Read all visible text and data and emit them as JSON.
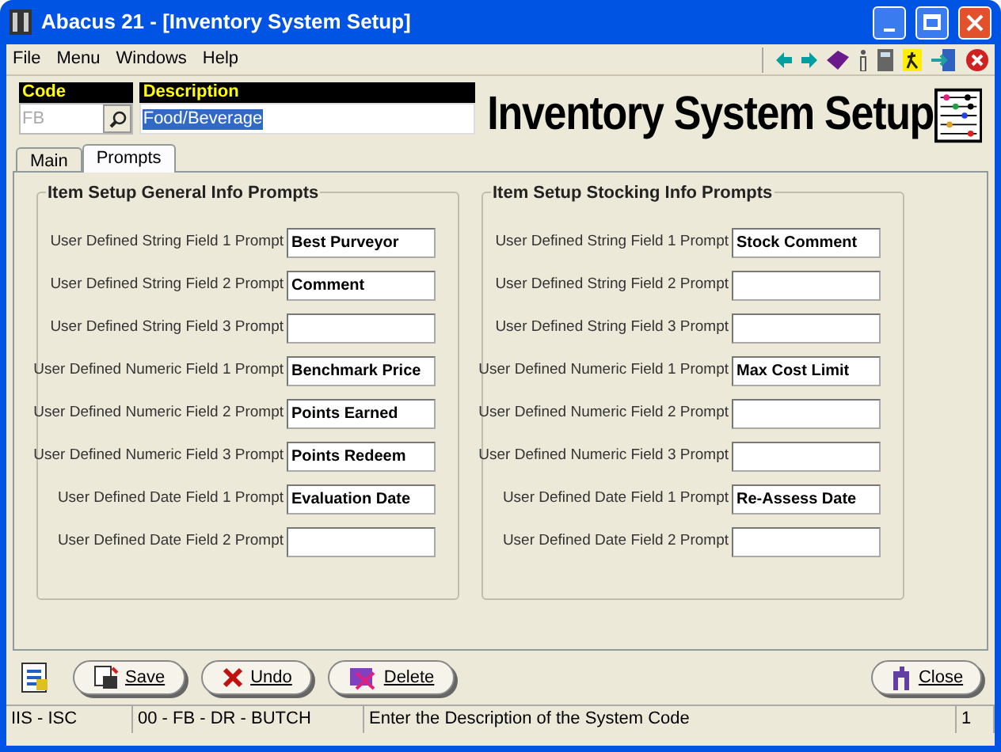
{
  "window": {
    "title": "Abacus 21 - [Inventory System Setup]"
  },
  "menu": [
    "File",
    "Menu",
    "Windows",
    "Help"
  ],
  "header": {
    "code": {
      "label": "Code",
      "value": "FB"
    },
    "description": {
      "label": "Description",
      "value": "Food/Beverage"
    },
    "banner": "Inventory System Setup"
  },
  "tabs": [
    {
      "label": "Main",
      "selected": false
    },
    {
      "label": "Prompts",
      "selected": true
    }
  ],
  "groups": [
    {
      "title": "Item Setup General Info Prompts",
      "fields": [
        {
          "label": "User Defined String Field 1 Prompt",
          "value": "Best Purveyor"
        },
        {
          "label": "User Defined String Field 2 Prompt",
          "value": "Comment"
        },
        {
          "label": "User Defined String Field 3 Prompt"
        },
        {
          "label": "User Defined Numeric Field 1 Prompt",
          "value": "Benchmark Price"
        },
        {
          "label": "User Defined Numeric Field 2 Prompt",
          "value": "Points Earned"
        },
        {
          "label": "User Defined Numeric Field 3 Prompt",
          "value": "Points Redeem"
        },
        {
          "label": "User Defined Date Field 1 Prompt",
          "value": "Evaluation Date"
        },
        {
          "label": "User Defined Date Field 2 Prompt"
        }
      ]
    },
    {
      "title": "Item Setup Stocking Info Prompts",
      "fields": [
        {
          "label": "User Defined String Field 1 Prompt",
          "value": "Stock Comment"
        },
        {
          "label": "User Defined String Field 2 Prompt"
        },
        {
          "label": "User Defined String Field 3 Prompt"
        },
        {
          "label": "User Defined Numeric Field 1 Prompt",
          "value": "Max Cost Limit"
        },
        {
          "label": "User Defined Numeric Field 2 Prompt"
        },
        {
          "label": "User Defined Numeric Field 3 Prompt"
        },
        {
          "label": "User Defined Date Field 1 Prompt",
          "value": "Re-Assess Date"
        },
        {
          "label": "User Defined Date Field 2 Prompt"
        }
      ]
    }
  ],
  "buttons": [
    {
      "label": "Save",
      "kind": "save"
    },
    {
      "label": "Undo",
      "kind": "undo"
    },
    {
      "label": "Delete",
      "kind": "delete"
    }
  ],
  "close_button": {
    "label": "Close"
  },
  "status_bar": [
    "IIS - ISC",
    "00 - FB - DR - BUTCH",
    "Enter the Description of the System Code",
    "1"
  ]
}
